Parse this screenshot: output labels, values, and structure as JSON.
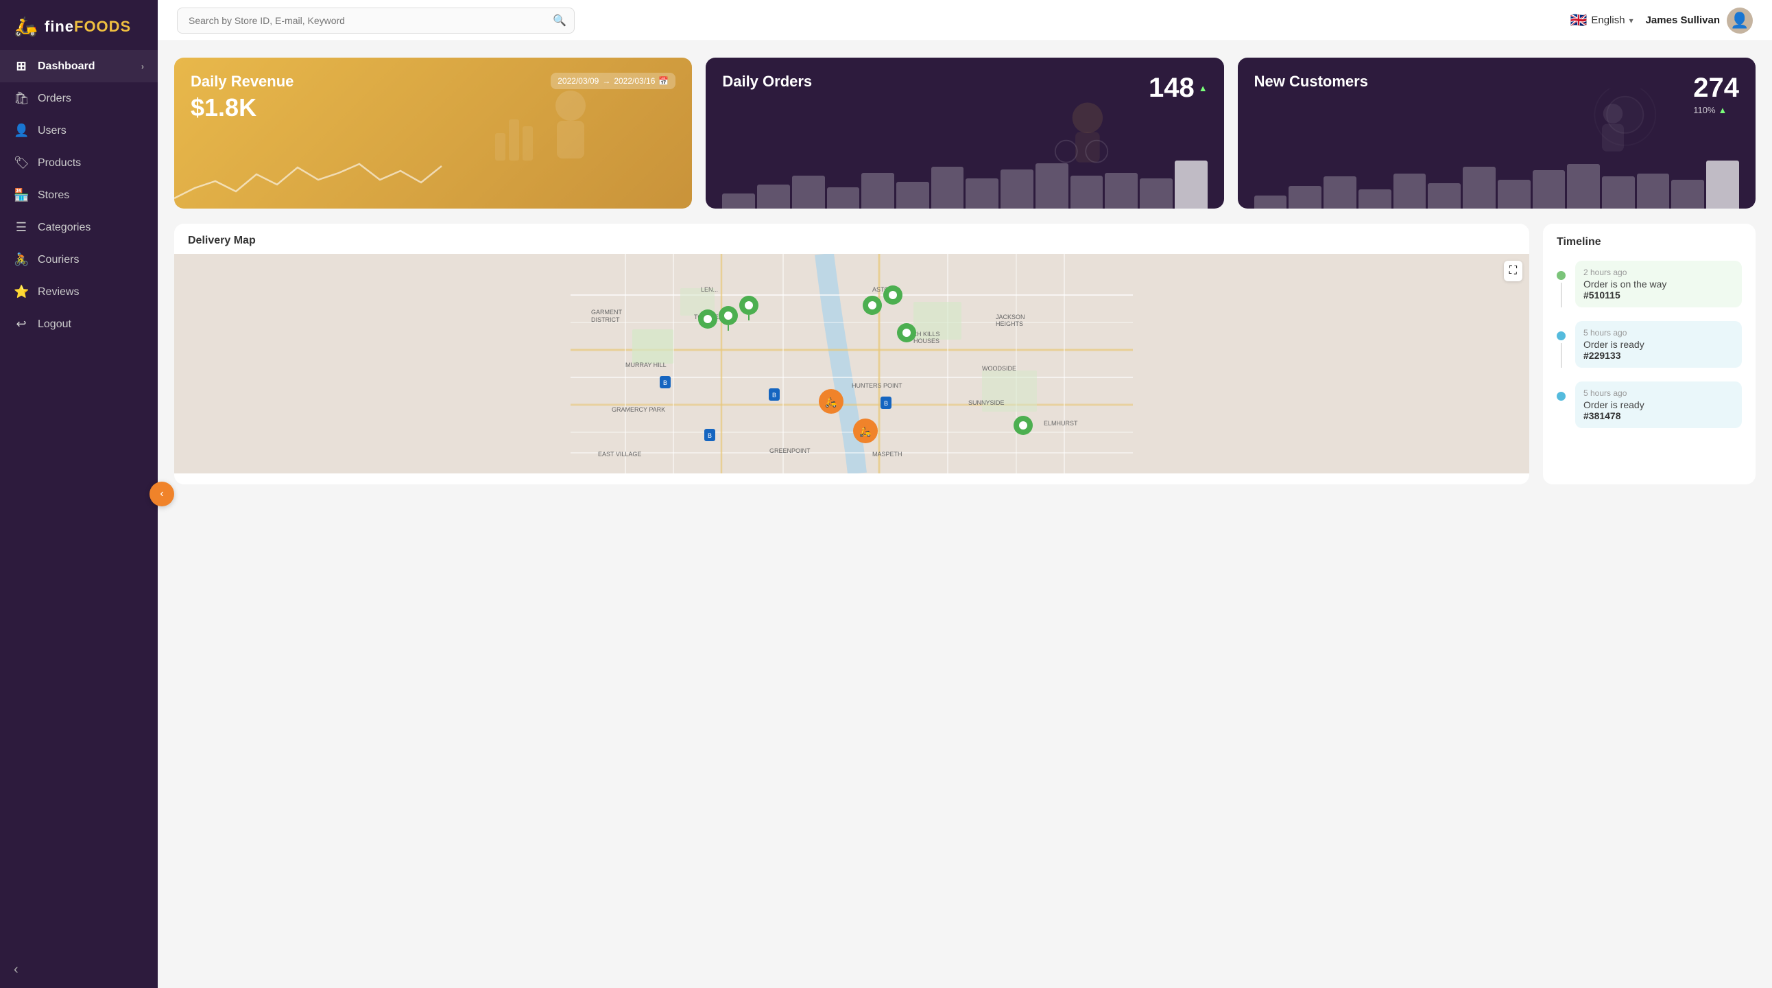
{
  "app": {
    "name": "finefoods",
    "logo_icon": "🛵"
  },
  "sidebar": {
    "items": [
      {
        "id": "dashboard",
        "label": "Dashboard",
        "icon": "⊞",
        "active": true,
        "has_chevron": true
      },
      {
        "id": "orders",
        "label": "Orders",
        "icon": "🛍",
        "active": false,
        "has_chevron": false
      },
      {
        "id": "users",
        "label": "Users",
        "icon": "👤",
        "active": false,
        "has_chevron": false
      },
      {
        "id": "products",
        "label": "Products",
        "icon": "🏷",
        "active": false,
        "has_chevron": false
      },
      {
        "id": "stores",
        "label": "Stores",
        "icon": "🏪",
        "active": false,
        "has_chevron": false
      },
      {
        "id": "categories",
        "label": "Categories",
        "icon": "☰",
        "active": false,
        "has_chevron": false
      },
      {
        "id": "couriers",
        "label": "Couriers",
        "icon": "🚴",
        "active": false,
        "has_chevron": false
      },
      {
        "id": "reviews",
        "label": "Reviews",
        "icon": "⭐",
        "active": false,
        "has_chevron": false
      },
      {
        "id": "logout",
        "label": "Logout",
        "icon": "⏻",
        "active": false,
        "has_chevron": false
      }
    ],
    "collapse_icon": "‹"
  },
  "header": {
    "search_placeholder": "Search by Store ID, E-mail, Keyword",
    "language": "English",
    "user_name": "James Sullivan"
  },
  "stat_cards": {
    "revenue": {
      "title": "Daily Revenue",
      "value": "$1.8K",
      "date_from": "2022/03/09",
      "date_to": "2022/03/16",
      "trend": "↑",
      "chart_bars": [
        30,
        45,
        55,
        40,
        60,
        50,
        70,
        55,
        65,
        80,
        50,
        60,
        45,
        75
      ]
    },
    "orders": {
      "title": "Daily Orders",
      "value": "148",
      "trend": "▲",
      "chart_bars": [
        25,
        40,
        55,
        35,
        60,
        45,
        70,
        50,
        65,
        75,
        55,
        60,
        50,
        80
      ]
    },
    "customers": {
      "title": "New Customers",
      "value": "274",
      "sub_value": "110%",
      "trend": "▲",
      "chart_bars": [
        20,
        35,
        50,
        30,
        55,
        40,
        65,
        45,
        60,
        70,
        50,
        55,
        45,
        75
      ]
    }
  },
  "delivery_map": {
    "title": "Delivery Map"
  },
  "timeline": {
    "title": "Timeline",
    "items": [
      {
        "time": "2 hours ago",
        "status": "Order is on the way",
        "order": "#510115",
        "dot_color": "green"
      },
      {
        "time": "5 hours ago",
        "status": "Order is ready",
        "order": "#229133",
        "dot_color": "teal"
      },
      {
        "time": "5 hours ago",
        "status": "Order is ready",
        "order": "#381478",
        "dot_color": "teal"
      }
    ]
  }
}
